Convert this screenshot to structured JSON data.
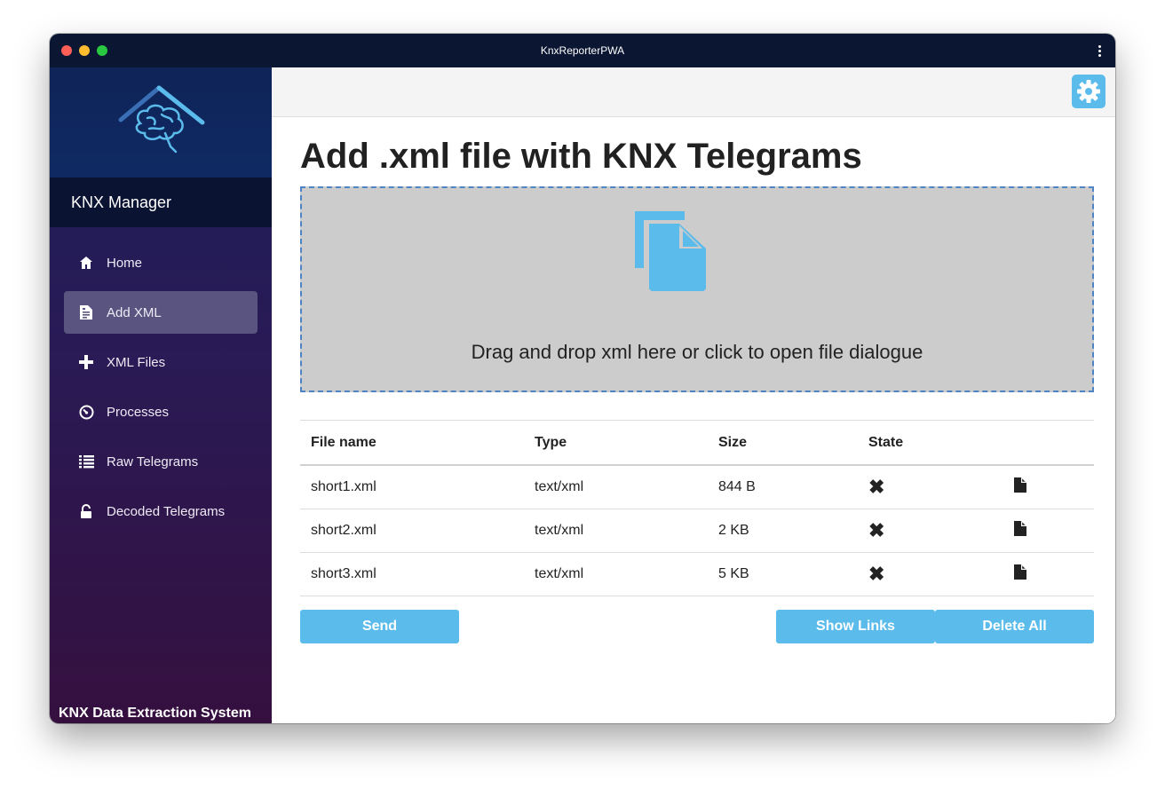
{
  "window": {
    "title": "KnxReporterPWA",
    "traffic_colors": [
      "#ff5f57",
      "#febc2e",
      "#28c840"
    ]
  },
  "sidebar": {
    "brand": "KNX Manager",
    "items": [
      {
        "label": "Home",
        "icon": "home-icon",
        "active": false
      },
      {
        "label": "Add XML",
        "icon": "document-list-icon",
        "active": true
      },
      {
        "label": "XML Files",
        "icon": "plus-icon",
        "active": false
      },
      {
        "label": "Processes",
        "icon": "dashboard-icon",
        "active": false
      },
      {
        "label": "Raw Telegrams",
        "icon": "list-icon",
        "active": false
      },
      {
        "label": "Decoded Telegrams",
        "icon": "unlock-icon",
        "active": false
      }
    ],
    "footer": "KNX Data Extraction System"
  },
  "main": {
    "title": "Add .xml file with KNX Telegrams",
    "dropzone_text": "Drag and drop xml here or click to open file dialogue",
    "table": {
      "headers": [
        "File name",
        "Type",
        "Size",
        "State"
      ],
      "rows": [
        {
          "name": "short1.xml",
          "type": "text/xml",
          "size": "844 B",
          "state_icon": "close-icon",
          "action_icon": "file-icon"
        },
        {
          "name": "short2.xml",
          "type": "text/xml",
          "size": "2 KB",
          "state_icon": "close-icon",
          "action_icon": "file-icon"
        },
        {
          "name": "short3.xml",
          "type": "text/xml",
          "size": "5 KB",
          "state_icon": "close-icon",
          "action_icon": "file-icon"
        }
      ]
    },
    "buttons": {
      "send": "Send",
      "show_links": "Show Links",
      "delete_all": "Delete All"
    }
  },
  "colors": {
    "accent": "#5bbcec",
    "titlebar": "#0b1633",
    "dropzone_bg": "#cccccc",
    "dropzone_border": "#4e84c4"
  }
}
